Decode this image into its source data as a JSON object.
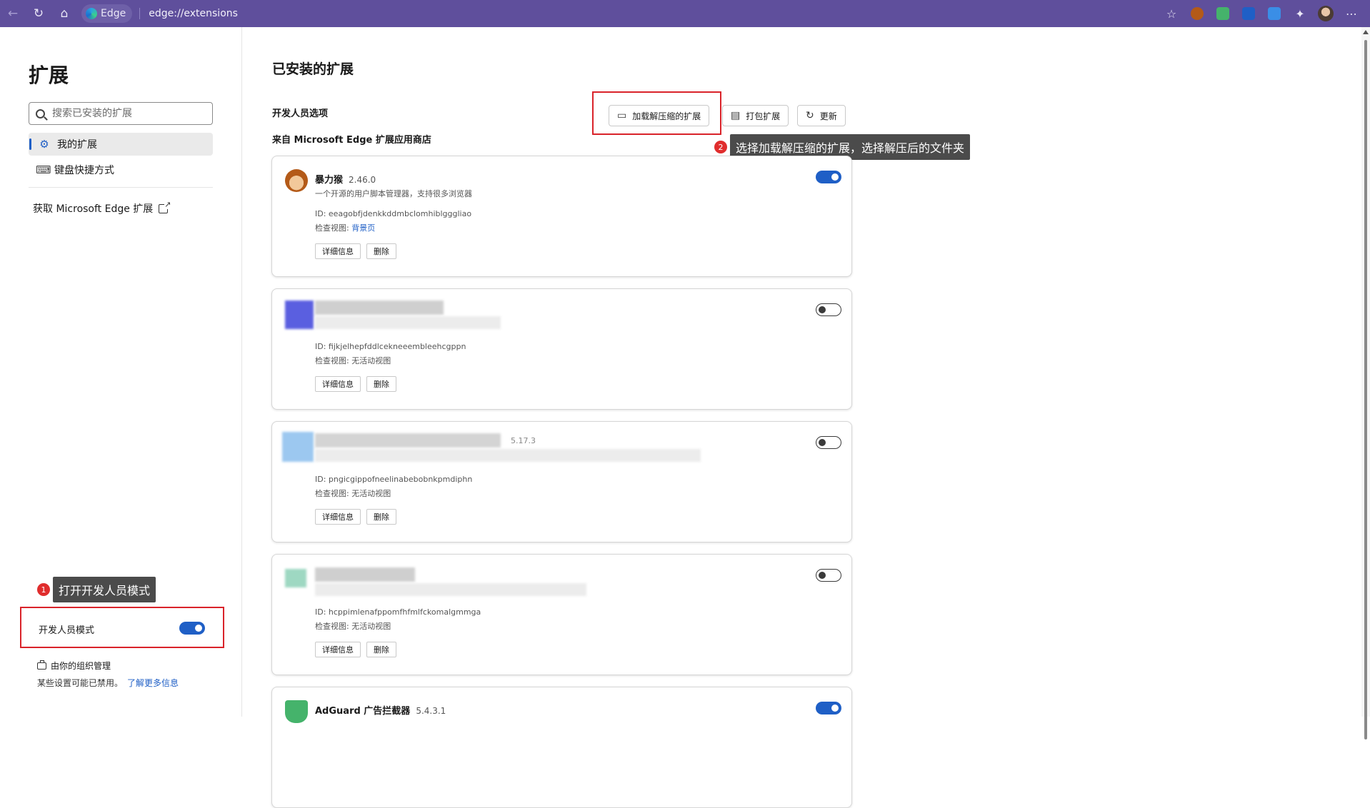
{
  "browser": {
    "brand": "Edge",
    "url": "edge://extensions"
  },
  "sidebar": {
    "title": "扩展",
    "search_placeholder": "搜索已安装的扩展",
    "items": [
      {
        "label": "我的扩展",
        "active": true
      },
      {
        "label": "键盘快捷方式",
        "active": false
      }
    ],
    "get_link": "获取 Microsoft Edge 扩展",
    "dev_mode_label": "开发人员模式",
    "dev_mode_on": true,
    "org_managed": "由你的组织管理",
    "org_note": "某些设置可能已禁用。",
    "learn_more": "了解更多信息"
  },
  "annotations": {
    "step1_num": "1",
    "step1_text": "打开开发人员模式",
    "step2_num": "2",
    "step2_text": "选择加载解压缩的扩展，选择解压后的文件夹",
    "highlight_color": "#d9232a"
  },
  "main": {
    "title": "已安装的扩展",
    "dev_options": "开发人员选项",
    "store_label": "来自 Microsoft Edge 扩展应用商店",
    "buttons": {
      "load_unpacked": "加载解压缩的扩展",
      "pack": "打包扩展",
      "update": "更新"
    }
  },
  "extensions": [
    {
      "name": "暴力猴",
      "version": "2.46.0",
      "description": "一个开源的用户脚本管理器，支持很多浏览器",
      "id": "ID: eeagobfjdenkkddmbclomhiblgggliao",
      "inspect_label": "检查视图:",
      "inspect_link": "背景页",
      "enabled": true,
      "details": "详细信息",
      "remove": "删除"
    },
    {
      "name": "",
      "version": "",
      "id": "ID: fijkjelhepfddlcekneeembleehcgppn",
      "inspect_label": "检查视图: 无活动视图",
      "enabled": false,
      "details": "详细信息",
      "remove": "删除"
    },
    {
      "name": "",
      "version": "5.17.3",
      "id": "ID: pngicgippofneelinabebobnkpmdiphn",
      "inspect_label": "检查视图: 无活动视图",
      "enabled": false,
      "details": "详细信息",
      "remove": "删除"
    },
    {
      "name": "",
      "version": "",
      "id": "ID: hcppimlenafppomfhfmlfckomalgmmga",
      "inspect_label": "检查视图: 无活动视图",
      "enabled": false,
      "details": "详细信息",
      "remove": "删除"
    },
    {
      "name": "AdGuard 广告拦截器",
      "version": "5.4.3.1",
      "enabled": true
    }
  ]
}
